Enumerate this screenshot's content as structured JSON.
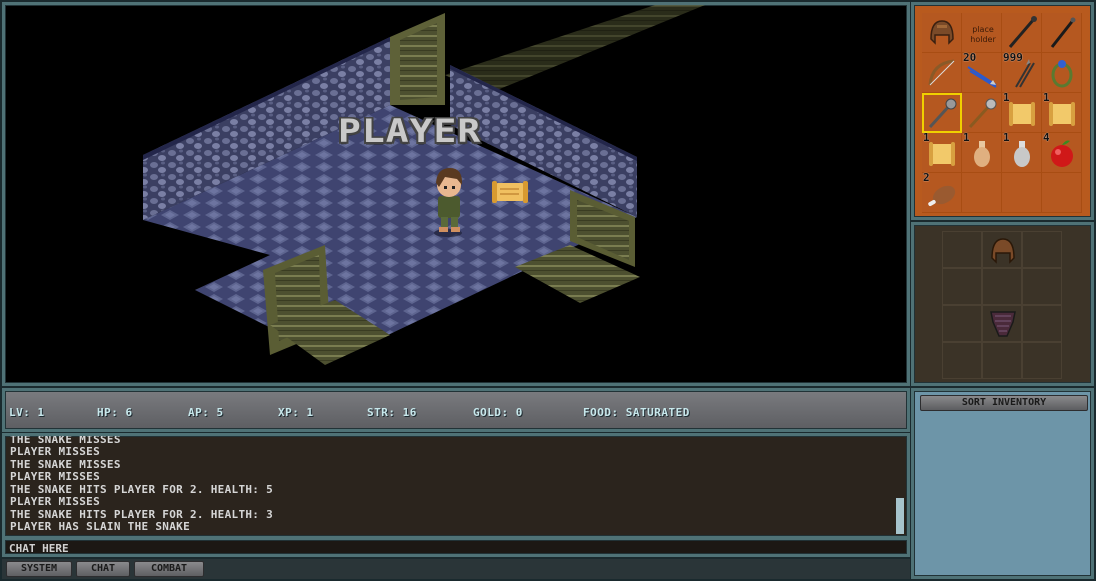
{
  "viewport": {
    "player_name": "PLAYER"
  },
  "inventory": {
    "placeholder_label": "place holder",
    "slots": [
      {
        "item": "leather-helmet",
        "qty": ""
      },
      {
        "item": "placeholder",
        "qty": ""
      },
      {
        "item": "dark-staff",
        "qty": ""
      },
      {
        "item": "dark-wand",
        "qty": ""
      },
      {
        "item": "wooden-bow",
        "qty": ""
      },
      {
        "item": "blue-arrows",
        "qty": "20"
      },
      {
        "item": "crossbow-bolts",
        "qty": "999"
      },
      {
        "item": "blue-ring",
        "qty": ""
      },
      {
        "item": "iron-mace",
        "qty": ""
      },
      {
        "item": "steel-mace",
        "qty": ""
      },
      {
        "item": "scroll",
        "qty": "1"
      },
      {
        "item": "scroll",
        "qty": "1"
      },
      {
        "item": "scroll",
        "qty": "1"
      },
      {
        "item": "potion",
        "qty": "1"
      },
      {
        "item": "potion",
        "qty": "1"
      },
      {
        "item": "red-apple",
        "qty": "4"
      },
      {
        "item": "meat",
        "qty": "2"
      }
    ]
  },
  "equipment": {
    "head": "leather-helmet",
    "body": "chainmail-armor"
  },
  "stats": {
    "level": "LV: 1",
    "hp": "HP: 6",
    "ap": "AP: 5",
    "xp": "XP: 1",
    "str": "STR: 16",
    "gold": "GOLD: 0",
    "food": "FOOD: SATURATED"
  },
  "chat_log": [
    "THE SNAKE MISSES",
    "PLAYER MISSES",
    "THE SNAKE MISSES",
    "PLAYER MISSES",
    "THE SNAKE HITS PLAYER FOR 2. HEALTH: 5",
    "PLAYER MISSES",
    "THE SNAKE HITS PLAYER FOR 2. HEALTH: 3",
    "PLAYER HAS SLAIN THE SNAKE"
  ],
  "chat_input": {
    "placeholder": "CHAT HERE"
  },
  "tabs": [
    "SYSTEM",
    "CHAT",
    "COMBAT"
  ],
  "sort_button": "SORT INVENTORY",
  "colors": {
    "inventory_bg": "#b85a1e",
    "selected_slot": "#f0d000",
    "frame": "#4f7276",
    "sort_panel": "#6d95a8"
  }
}
